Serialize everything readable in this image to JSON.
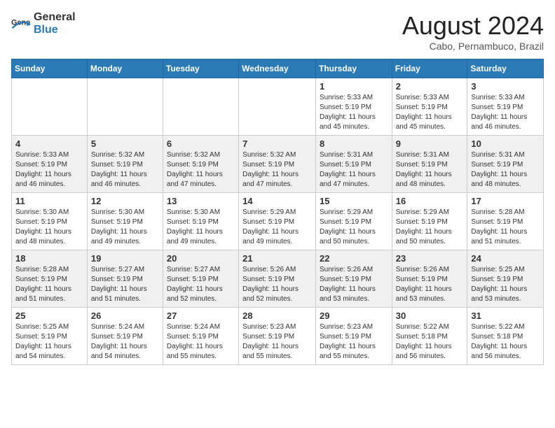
{
  "header": {
    "logo_general": "General",
    "logo_blue": "Blue",
    "month_title": "August 2024",
    "location": "Cabo, Pernambuco, Brazil"
  },
  "days_of_week": [
    "Sunday",
    "Monday",
    "Tuesday",
    "Wednesday",
    "Thursday",
    "Friday",
    "Saturday"
  ],
  "weeks": [
    [
      {
        "day": "",
        "info": ""
      },
      {
        "day": "",
        "info": ""
      },
      {
        "day": "",
        "info": ""
      },
      {
        "day": "",
        "info": ""
      },
      {
        "day": "1",
        "info": "Sunrise: 5:33 AM\nSunset: 5:19 PM\nDaylight: 11 hours\nand 45 minutes."
      },
      {
        "day": "2",
        "info": "Sunrise: 5:33 AM\nSunset: 5:19 PM\nDaylight: 11 hours\nand 45 minutes."
      },
      {
        "day": "3",
        "info": "Sunrise: 5:33 AM\nSunset: 5:19 PM\nDaylight: 11 hours\nand 46 minutes."
      }
    ],
    [
      {
        "day": "4",
        "info": "Sunrise: 5:33 AM\nSunset: 5:19 PM\nDaylight: 11 hours\nand 46 minutes."
      },
      {
        "day": "5",
        "info": "Sunrise: 5:32 AM\nSunset: 5:19 PM\nDaylight: 11 hours\nand 46 minutes."
      },
      {
        "day": "6",
        "info": "Sunrise: 5:32 AM\nSunset: 5:19 PM\nDaylight: 11 hours\nand 47 minutes."
      },
      {
        "day": "7",
        "info": "Sunrise: 5:32 AM\nSunset: 5:19 PM\nDaylight: 11 hours\nand 47 minutes."
      },
      {
        "day": "8",
        "info": "Sunrise: 5:31 AM\nSunset: 5:19 PM\nDaylight: 11 hours\nand 47 minutes."
      },
      {
        "day": "9",
        "info": "Sunrise: 5:31 AM\nSunset: 5:19 PM\nDaylight: 11 hours\nand 48 minutes."
      },
      {
        "day": "10",
        "info": "Sunrise: 5:31 AM\nSunset: 5:19 PM\nDaylight: 11 hours\nand 48 minutes."
      }
    ],
    [
      {
        "day": "11",
        "info": "Sunrise: 5:30 AM\nSunset: 5:19 PM\nDaylight: 11 hours\nand 48 minutes."
      },
      {
        "day": "12",
        "info": "Sunrise: 5:30 AM\nSunset: 5:19 PM\nDaylight: 11 hours\nand 49 minutes."
      },
      {
        "day": "13",
        "info": "Sunrise: 5:30 AM\nSunset: 5:19 PM\nDaylight: 11 hours\nand 49 minutes."
      },
      {
        "day": "14",
        "info": "Sunrise: 5:29 AM\nSunset: 5:19 PM\nDaylight: 11 hours\nand 49 minutes."
      },
      {
        "day": "15",
        "info": "Sunrise: 5:29 AM\nSunset: 5:19 PM\nDaylight: 11 hours\nand 50 minutes."
      },
      {
        "day": "16",
        "info": "Sunrise: 5:29 AM\nSunset: 5:19 PM\nDaylight: 11 hours\nand 50 minutes."
      },
      {
        "day": "17",
        "info": "Sunrise: 5:28 AM\nSunset: 5:19 PM\nDaylight: 11 hours\nand 51 minutes."
      }
    ],
    [
      {
        "day": "18",
        "info": "Sunrise: 5:28 AM\nSunset: 5:19 PM\nDaylight: 11 hours\nand 51 minutes."
      },
      {
        "day": "19",
        "info": "Sunrise: 5:27 AM\nSunset: 5:19 PM\nDaylight: 11 hours\nand 51 minutes."
      },
      {
        "day": "20",
        "info": "Sunrise: 5:27 AM\nSunset: 5:19 PM\nDaylight: 11 hours\nand 52 minutes."
      },
      {
        "day": "21",
        "info": "Sunrise: 5:26 AM\nSunset: 5:19 PM\nDaylight: 11 hours\nand 52 minutes."
      },
      {
        "day": "22",
        "info": "Sunrise: 5:26 AM\nSunset: 5:19 PM\nDaylight: 11 hours\nand 53 minutes."
      },
      {
        "day": "23",
        "info": "Sunrise: 5:26 AM\nSunset: 5:19 PM\nDaylight: 11 hours\nand 53 minutes."
      },
      {
        "day": "24",
        "info": "Sunrise: 5:25 AM\nSunset: 5:19 PM\nDaylight: 11 hours\nand 53 minutes."
      }
    ],
    [
      {
        "day": "25",
        "info": "Sunrise: 5:25 AM\nSunset: 5:19 PM\nDaylight: 11 hours\nand 54 minutes."
      },
      {
        "day": "26",
        "info": "Sunrise: 5:24 AM\nSunset: 5:19 PM\nDaylight: 11 hours\nand 54 minutes."
      },
      {
        "day": "27",
        "info": "Sunrise: 5:24 AM\nSunset: 5:19 PM\nDaylight: 11 hours\nand 55 minutes."
      },
      {
        "day": "28",
        "info": "Sunrise: 5:23 AM\nSunset: 5:19 PM\nDaylight: 11 hours\nand 55 minutes."
      },
      {
        "day": "29",
        "info": "Sunrise: 5:23 AM\nSunset: 5:19 PM\nDaylight: 11 hours\nand 55 minutes."
      },
      {
        "day": "30",
        "info": "Sunrise: 5:22 AM\nSunset: 5:18 PM\nDaylight: 11 hours\nand 56 minutes."
      },
      {
        "day": "31",
        "info": "Sunrise: 5:22 AM\nSunset: 5:18 PM\nDaylight: 11 hours\nand 56 minutes."
      }
    ]
  ]
}
